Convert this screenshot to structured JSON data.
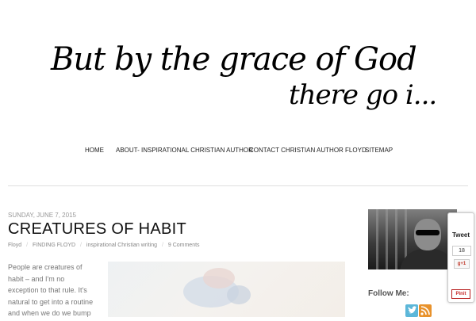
{
  "header": {
    "title_line1": "But by the grace of God",
    "title_line2": "there go i..."
  },
  "nav": {
    "items": [
      {
        "label": "HOME"
      },
      {
        "label": "ABOUT- INSPIRATIONAL CHRISTIAN AUTHOR"
      },
      {
        "label": "CONTACT CHRISTIAN AUTHOR FLOYD"
      },
      {
        "label": "SITEMAP"
      }
    ]
  },
  "post": {
    "date": "SUNDAY, JUNE 7, 2015",
    "title": "CREATURES OF HABIT",
    "meta": {
      "author": "Floyd",
      "category1": "FINDING FLOYD",
      "category2": "inspirational Christian writing",
      "comments": "9 Comments"
    },
    "body_lines": [
      "People are creatures of",
      "habit – and I'm no",
      "exception to that rule. It's",
      "natural to get into a routine",
      "and when we do we bump"
    ]
  },
  "sidebar": {
    "follow_label": "Follow Me:",
    "icons": [
      "twitter-icon",
      "rss-icon"
    ]
  },
  "share": {
    "tweet_label": "Tweet",
    "tweet_count": "18",
    "gplus_label": "g+1",
    "pinit_label": "Pinit"
  }
}
